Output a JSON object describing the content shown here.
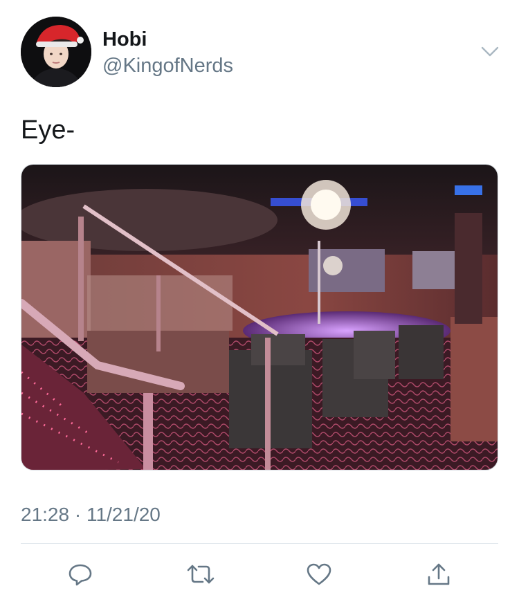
{
  "user": {
    "display_name": "Hobi",
    "handle": "@KingofNerds",
    "avatar_icon": "user-avatar"
  },
  "tweet": {
    "text": "Eye-",
    "timestamp": "21:28 · 11/21/20",
    "media_alt": "nightclub-interior-photo"
  },
  "actions": {
    "reply_icon": "reply-icon",
    "retweet_icon": "retweet-icon",
    "like_icon": "heart-icon",
    "share_icon": "share-icon",
    "menu_icon": "chevron-down-icon"
  },
  "colors": {
    "primary_text": "#14171a",
    "secondary_text": "#657786",
    "divider": "#e1e8ed",
    "icon": "#657786"
  }
}
